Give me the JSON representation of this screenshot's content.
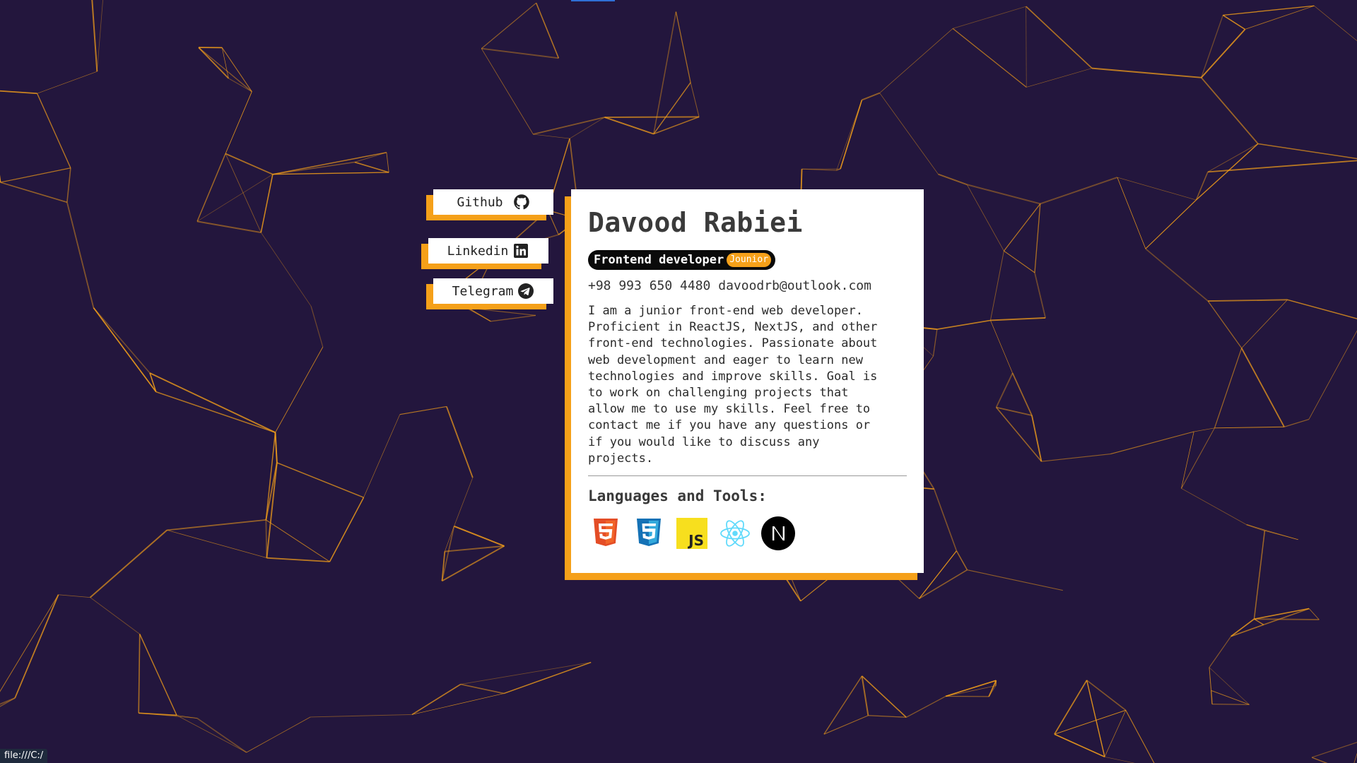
{
  "social": {
    "github_label": "Github",
    "linkedin_label": "Linkedin",
    "telegram_label": "Telegram"
  },
  "profile": {
    "name": "Davood Rabiei",
    "role": "Frontend developer",
    "level": "Jounior",
    "phone": "+98 993 650 4480",
    "email": "davoodrb@outlook.com",
    "bio": "I am a junior front-end web developer.\nProficient in ReactJS, NextJS, and other\nfront-end technologies. Passionate about\nweb development and eager to learn new\ntechnologies and improve skills. Goal is\nto work on challenging projects that\nallow me to use my skills. Feel free to\ncontact me if you have any questions or\nif you would like to discuss any\nprojects."
  },
  "tools": {
    "title": "Languages and Tools:",
    "items": [
      "html5-icon",
      "css3-icon",
      "javascript-icon",
      "react-icon",
      "nextjs-icon"
    ]
  },
  "status_bar": {
    "url": "file:///C:/"
  },
  "colors": {
    "background": "#23163d",
    "accent": "#f5a019",
    "card": "#ffffff",
    "network_line": "#f5a019"
  }
}
